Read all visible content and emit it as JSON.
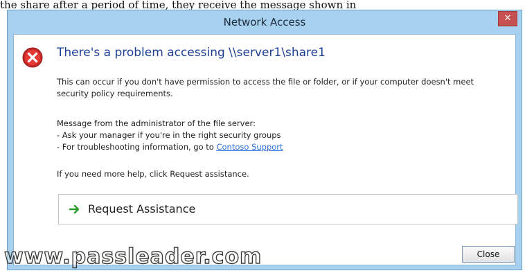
{
  "background": {
    "text": "the share after a period of time, they receive the message shown in"
  },
  "dialog": {
    "title": "Network Access",
    "close_glyph": "✕",
    "headline": "There's a problem accessing \\\\server1\\share1",
    "description": "This can occur if you don't have permission to access the file or folder, or if your computer doesn't meet security policy requirements.",
    "admin_header": "Message from the administrator of the file server:",
    "admin_line1": "- Ask your manager if you're in the right security groups",
    "admin_line2_prefix": "- For troubleshooting information, go to ",
    "admin_link": "Contoso Support",
    "help_text": "If you need more help, click Request assistance.",
    "request_label": "Request Assistance",
    "close_button": "Close"
  },
  "watermark": "www.passleader.com",
  "icons": {
    "error": "error-icon",
    "arrow": "arrow-right-icon",
    "close": "close-icon"
  },
  "colors": {
    "titlebar": "#a8d0ef",
    "close_red": "#c75050",
    "headline_blue": "#1c3f95",
    "link_blue": "#2b6fd8",
    "arrow_green": "#2e9b2e"
  }
}
